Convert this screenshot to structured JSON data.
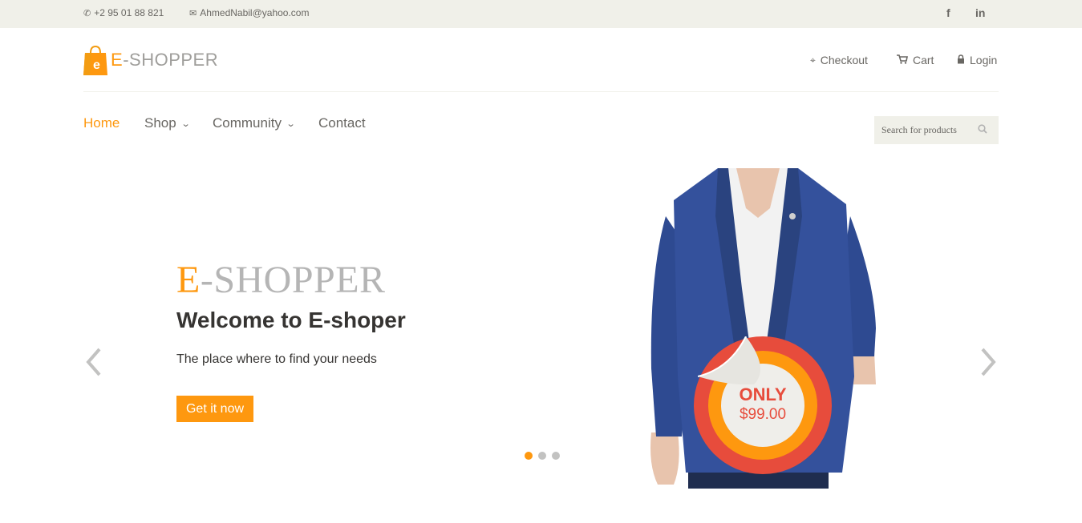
{
  "topbar": {
    "phone": "+2 95 01 88 821",
    "email": "AhmedNabil@yahoo.com",
    "social": [
      "f",
      "in"
    ]
  },
  "header": {
    "logo_letter": "e",
    "logo_first": "E",
    "logo_rest": "-SHOPPER",
    "menu": {
      "checkout": "Checkout",
      "cart": "Cart",
      "login": "Login"
    }
  },
  "nav": {
    "home": "Home",
    "shop": "Shop",
    "community": "Community",
    "contact": "Contact"
  },
  "search": {
    "placeholder": "Search for products"
  },
  "slider": {
    "brand_first": "E",
    "brand_rest": "-SHOPPER",
    "title": "Welcome to E-shoper",
    "subtitle": "The place where to find your needs",
    "cta": "Get it now",
    "active_slide": 1,
    "slide_count": 3
  },
  "badge": {
    "only": "ONLY",
    "price": "$99.00"
  },
  "icons": {
    "phone": "phone-icon",
    "email": "envelope-icon",
    "checkout": "crosshairs-icon",
    "cart": "shopping-cart-icon",
    "login": "lock-icon",
    "search": "search-icon",
    "prev": "chevron-left-icon",
    "next": "chevron-right-icon"
  },
  "colors": {
    "accent": "#fe980f",
    "topbar_bg": "#f0f0e9",
    "text": "#696763",
    "badge_red": "#e74c3c"
  }
}
